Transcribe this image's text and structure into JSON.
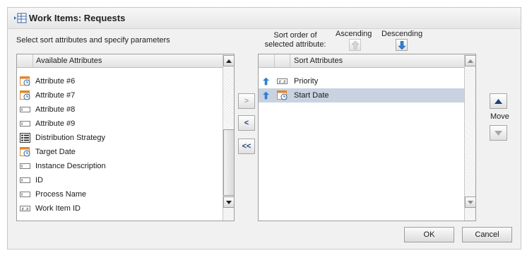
{
  "dialog": {
    "title": "Work Items: Requests",
    "title_icon": "table-icon",
    "instruction": "Select sort attributes and specify parameters"
  },
  "sort_order": {
    "label_line1": "Sort order of",
    "label_line2": "selected attribute:",
    "ascending_label": "Ascending",
    "descending_label": "Descending"
  },
  "available": {
    "header": "Available Attributes",
    "items": [
      {
        "label": "Attribute #6",
        "icon": "date-icon"
      },
      {
        "label": "Attribute #7",
        "icon": "date-icon"
      },
      {
        "label": "Attribute #8",
        "icon": "text-field-icon"
      },
      {
        "label": "Attribute #9",
        "icon": "text-field-icon"
      },
      {
        "label": "Distribution Strategy",
        "icon": "list-icon"
      },
      {
        "label": "Target Date",
        "icon": "date-icon"
      },
      {
        "label": "Instance Description",
        "icon": "text-field-icon"
      },
      {
        "label": "ID",
        "icon": "text-field-icon"
      },
      {
        "label": "Process Name",
        "icon": "text-field-icon"
      },
      {
        "label": "Work Item ID",
        "icon": "number-field-icon"
      }
    ]
  },
  "sorted": {
    "header": "Sort Attributes",
    "items": [
      {
        "label": "Priority",
        "icon": "number-field-icon",
        "order": "ascending",
        "selected": false
      },
      {
        "label": "Start Date",
        "icon": "date-icon",
        "order": "ascending",
        "selected": true
      }
    ]
  },
  "transfer": {
    "add_glyph": ">",
    "remove_glyph": "<",
    "remove_all_glyph": "<<"
  },
  "move": {
    "label": "Move"
  },
  "buttons": {
    "ok": "OK",
    "cancel": "Cancel"
  },
  "colors": {
    "selection": "#c9d2e0",
    "arrow_blue": "#2f7fd6",
    "dialog_bg": "#f1f1f1"
  }
}
